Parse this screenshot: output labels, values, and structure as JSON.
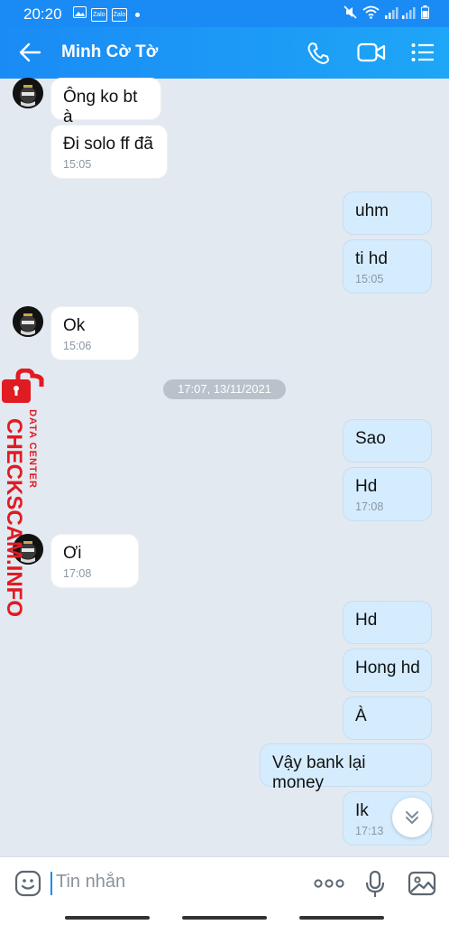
{
  "status_bar": {
    "time": "20:20",
    "app_badges": [
      "Zalo",
      "Zalo"
    ]
  },
  "header": {
    "contact_name": "Minh Cờ Tờ"
  },
  "messages": [
    {
      "dir": "in",
      "text": "Ông ko bt à",
      "time": ""
    },
    {
      "dir": "in",
      "text": "Đi solo ff đã",
      "time": "15:05"
    },
    {
      "dir": "out",
      "text": "uhm",
      "time": ""
    },
    {
      "dir": "out",
      "text": "ti hd",
      "time": "15:05"
    },
    {
      "dir": "in",
      "text": "Ok",
      "time": "15:06"
    },
    {
      "dir": "out",
      "text": "Sao",
      "time": ""
    },
    {
      "dir": "out",
      "text": "Hd",
      "time": "17:08"
    },
    {
      "dir": "in",
      "text": "Ơi",
      "time": "17:08"
    },
    {
      "dir": "out",
      "text": "Hd",
      "time": ""
    },
    {
      "dir": "out",
      "text": "Hong hd",
      "time": ""
    },
    {
      "dir": "out",
      "text": "À",
      "time": ""
    },
    {
      "dir": "out",
      "text": "Vậy bank lại money",
      "time": ""
    },
    {
      "dir": "out",
      "text": "Ik",
      "time": "17:13"
    }
  ],
  "date_separator": "17:07, 13/11/2021",
  "watermark": {
    "main": "CHECKSCAM.INFO",
    "sub": "DATA CENTER"
  },
  "input": {
    "placeholder": "Tin nhắn"
  },
  "colors": {
    "accent": "#1a8bf5",
    "outgoing_bubble": "#d4ecfd",
    "incoming_bubble": "#ffffff",
    "chat_bg": "#e2e9f1",
    "watermark": "#e11b22"
  }
}
